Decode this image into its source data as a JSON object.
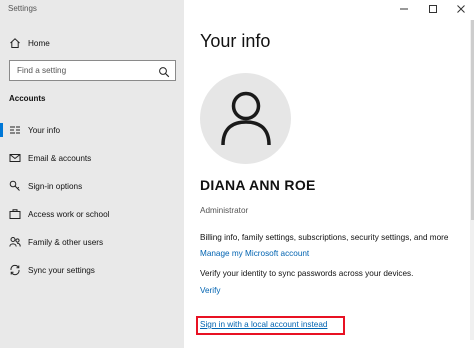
{
  "window": {
    "title": "Settings",
    "controls": [
      "minimize",
      "maximize",
      "close"
    ]
  },
  "sidebar": {
    "home_label": "Home",
    "search_placeholder": "Find a setting",
    "section_label": "Accounts",
    "items": [
      {
        "label": "Your info",
        "icon": "user-card-icon",
        "selected": true
      },
      {
        "label": "Email & accounts",
        "icon": "mail-icon",
        "selected": false
      },
      {
        "label": "Sign-in options",
        "icon": "key-icon",
        "selected": false
      },
      {
        "label": "Access work or school",
        "icon": "briefcase-icon",
        "selected": false
      },
      {
        "label": "Family & other users",
        "icon": "people-icon",
        "selected": false
      },
      {
        "label": "Sync your settings",
        "icon": "sync-icon",
        "selected": false
      }
    ]
  },
  "main": {
    "title": "Your info",
    "user_name": "DIANA ANN ROE",
    "user_role": "Administrator",
    "billing_text": "Billing info, family settings, subscriptions, security settings, and more",
    "manage_link": "Manage my Microsoft account",
    "verify_text": "Verify your identity to sync passwords across your devices.",
    "verify_link": "Verify",
    "local_account_link": "Sign in with a local account instead"
  },
  "colors": {
    "accent": "#0078d7",
    "link": "#0063b1",
    "highlight_box": "#e81123",
    "sidebar_bg": "#e9e9e9"
  }
}
